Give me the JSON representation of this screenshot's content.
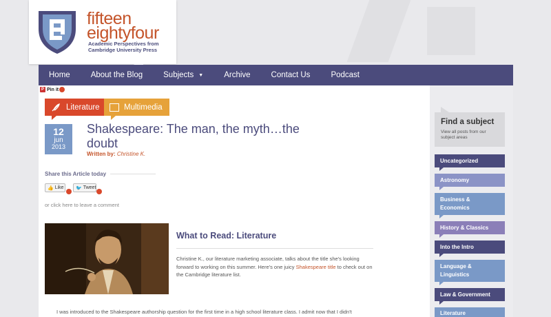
{
  "brand": {
    "line1": "fifteen",
    "line2": "eightyfour",
    "tagline": "Academic Perspectives from Cambridge University Press",
    "color": "#c4542a"
  },
  "nav": {
    "items": [
      {
        "label": "Home"
      },
      {
        "label": "About the Blog"
      },
      {
        "label": "Subjects",
        "has_caret": true
      },
      {
        "label": "Archive"
      },
      {
        "label": "Contact Us"
      },
      {
        "label": "Podcast"
      }
    ],
    "background": "#4b4b7c"
  },
  "pin": {
    "label": "Pin it"
  },
  "post": {
    "categories": [
      {
        "label": "Literature",
        "color": "#d9482b"
      },
      {
        "label": "Multimedia",
        "color": "#e6a23a"
      }
    ],
    "date": {
      "day": "12",
      "month": "jun",
      "year": "2013"
    },
    "title": "Shakespeare: The man, the myth…the doubt",
    "byline_label": "Written by:",
    "author": "Christine K.",
    "share_title": "Share this Article today",
    "like_label": "Like",
    "tweet_label": "Tweet",
    "comment_link": "or click here to leave a comment",
    "section_heading": "What to Read: Literature",
    "intro_before": "Christine K., our literature marketing associate, talks about the title she's looking forward to working on this summer. Here's one juicy ",
    "intro_link": "Shakespeare title",
    "intro_after": " to check out on the Cambridge literature list.",
    "body_start": "I was introduced to the Shakespeare authorship question for the first time in a high school literature class. I admit now that I didn't"
  },
  "sidebar": {
    "find_title": "Find a subject",
    "find_sub": "View all posts from our subject areas",
    "items": [
      {
        "label": "Uncategorized",
        "color": "#4b4b7c"
      },
      {
        "label": "Astronomy",
        "color": "#8b93c6"
      },
      {
        "label": "Business & Economics",
        "color": "#7a99c7"
      },
      {
        "label": "History & Classics",
        "color": "#8b7fb8"
      },
      {
        "label": "Into the Intro",
        "color": "#4b4b7c"
      },
      {
        "label": "Language & Linguistics",
        "color": "#7a99c7"
      },
      {
        "label": "Law & Government",
        "color": "#4b4b7c"
      },
      {
        "label": "Literature",
        "color": "#7a99c7"
      }
    ]
  }
}
